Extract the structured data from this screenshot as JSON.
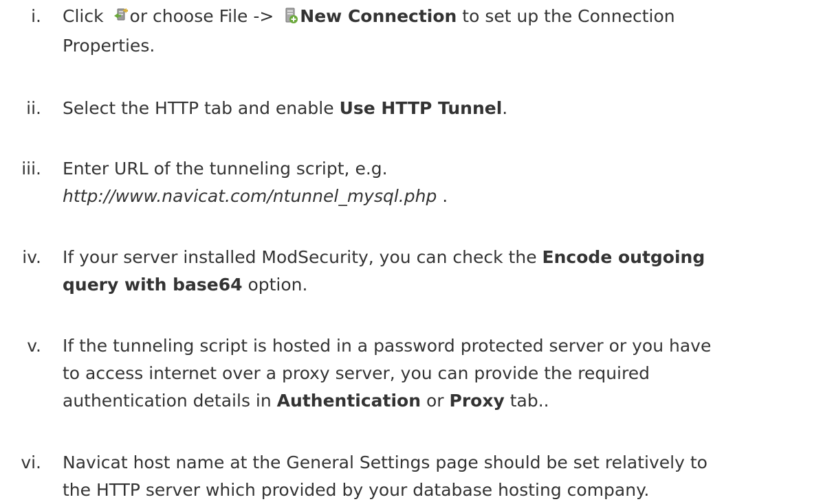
{
  "steps": [
    {
      "numeral": "i.",
      "lines": [
        {
          "pre": "Click ",
          "icon1": "connection-icon",
          "mid": "or choose File -> ",
          "icon2": "new-connection-icon",
          "bold": "New Connection",
          "post": " to set up the Connection"
        },
        {
          "text": "Properties."
        }
      ]
    },
    {
      "numeral": "ii.",
      "pre": "Select the HTTP tab and enable ",
      "bold": "Use HTTP Tunnel",
      "post": "."
    },
    {
      "numeral": "iii.",
      "line1": "Enter URL of the tunneling script, e.g.",
      "url": "http://www.navicat.com/ntunnel_mysql.php",
      "url_post": " ."
    },
    {
      "numeral": "iv.",
      "pre": "If your server installed ModSecurity, you can check the ",
      "bold1": "Encode outgoing",
      "bold2": "query with base64",
      "post": " option."
    },
    {
      "numeral": "v.",
      "line1": "If the tunneling script is hosted in a password protected server or you have",
      "line2": "to access internet over a proxy server, you can provide the required",
      "line3_pre": "authentication details in ",
      "bold1": "Authentication",
      "mid": " or ",
      "bold2": "Proxy",
      "post": " tab.."
    },
    {
      "numeral": "vi.",
      "line1": "Navicat host name at the General Settings page should be set relatively to",
      "line2": "the HTTP server which provided by your database hosting company."
    }
  ],
  "colors": {
    "text": "#333333",
    "icon_green": "#6aa83a",
    "icon_gold": "#d9b23c",
    "icon_grey": "#9a9a9a"
  }
}
